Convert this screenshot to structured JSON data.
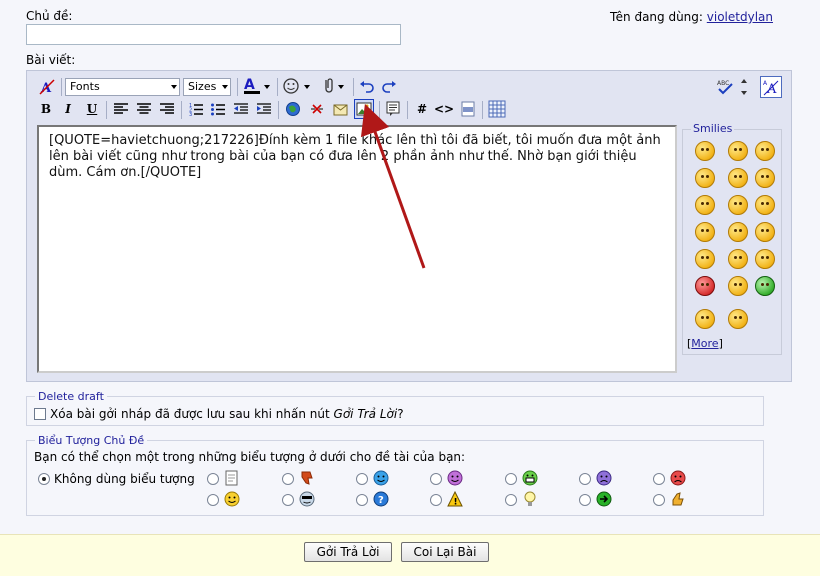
{
  "title": {
    "label": "Chủ đề:",
    "value": ""
  },
  "user": {
    "label": "Tên đang dùng:",
    "name": "violetdylan"
  },
  "post": {
    "label": "Bài viết:",
    "content": "[QUOTE=havietchuong;217226]Đính kèm 1 file khác lên thì tôi đã biết, tôi muốn đưa một ảnh lên bài viết cũng như trong bài của bạn có đưa lên 2 phần ảnh như thế. Nhờ bạn giới thiệu dùm. Cám ơn.[/QUOTE]"
  },
  "toolbar": {
    "font_select": "Fonts",
    "size_select": "Sizes",
    "bold": "B",
    "italic": "I",
    "underline": "U",
    "wrap_code": "#",
    "wrap_html": "<>"
  },
  "smilies": {
    "legend": "Smilies",
    "more": "More",
    "more_open": "[",
    "more_close": "]"
  },
  "delete_draft": {
    "legend": "Delete draft",
    "text": "Xóa bài gởi nháp đã được lưu sau khi nhấn nút ",
    "button_ref": "Gởi Trả Lời",
    "suffix": "?"
  },
  "post_icons": {
    "legend": "Biểu Tượng Chủ Đề",
    "instruction": "Bạn có thể chọn một trong những biểu tượng ở dưới cho đề tài của bạn:",
    "no_icon": "Không dùng biểu tượng"
  },
  "footer": {
    "submit": "Gởi Trả Lời",
    "preview": "Coi Lại Bài"
  },
  "colors": {
    "link": "#22229c",
    "annotation_arrow": "#b01818"
  }
}
